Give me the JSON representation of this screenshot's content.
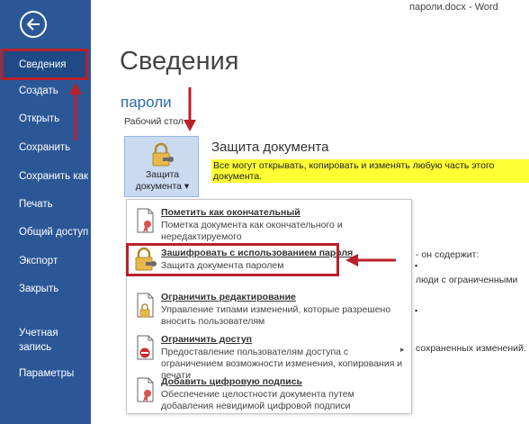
{
  "window": {
    "doc_title": "пароли.docx - Word"
  },
  "sidebar": {
    "items": [
      {
        "label": "Сведения"
      },
      {
        "label": "Создать"
      },
      {
        "label": "Открыть"
      },
      {
        "label": "Сохранить"
      },
      {
        "label": "Сохранить как"
      },
      {
        "label": "Печать"
      },
      {
        "label": "Общий доступ"
      },
      {
        "label": "Экспорт"
      },
      {
        "label": "Закрыть"
      },
      {
        "label": "Учетная\nзапись"
      },
      {
        "label": "Параметры"
      }
    ]
  },
  "main": {
    "title": "Сведения",
    "doc_name": "пароли",
    "location": "Рабочий стол",
    "protect_button": {
      "line1": "Защита",
      "line2": "документа ▾"
    },
    "protect_section": {
      "title": "Защита документа",
      "description": "Все могут открывать, копировать и изменять любую часть этого документа."
    },
    "background_snippets": {
      "contains": "- он содержит:",
      "people": "люди с ограниченными",
      "saved": "сохраненных изменений."
    }
  },
  "menu": {
    "items": [
      {
        "label": "Пометить как окончательный",
        "desc": "Пометка документа как окончательного и нередактируемого",
        "icon": "final-document-icon"
      },
      {
        "label": "Зашифровать с использованием пароля",
        "desc": "Защита документа паролем",
        "icon": "lock-key-icon"
      },
      {
        "label": "Ограничить редактирование",
        "desc": "Управление типами изменений, которые разрешено вносить пользователям",
        "icon": "restrict-edit-icon"
      },
      {
        "label": "Ограничить доступ",
        "desc": "Предоставление пользователям доступа с ограничением возможности изменения, копирования и печати",
        "icon": "restrict-access-icon"
      },
      {
        "label": "Добавить цифровую подпись",
        "desc": "Обеспечение целостности документа путем добавления невидимой цифровой подписи",
        "icon": "digital-signature-icon"
      }
    ]
  },
  "colors": {
    "sidebar": "#2b5797",
    "highlight": "#ffff33",
    "annotation": "#b8202a",
    "button": "#c9daf1"
  }
}
